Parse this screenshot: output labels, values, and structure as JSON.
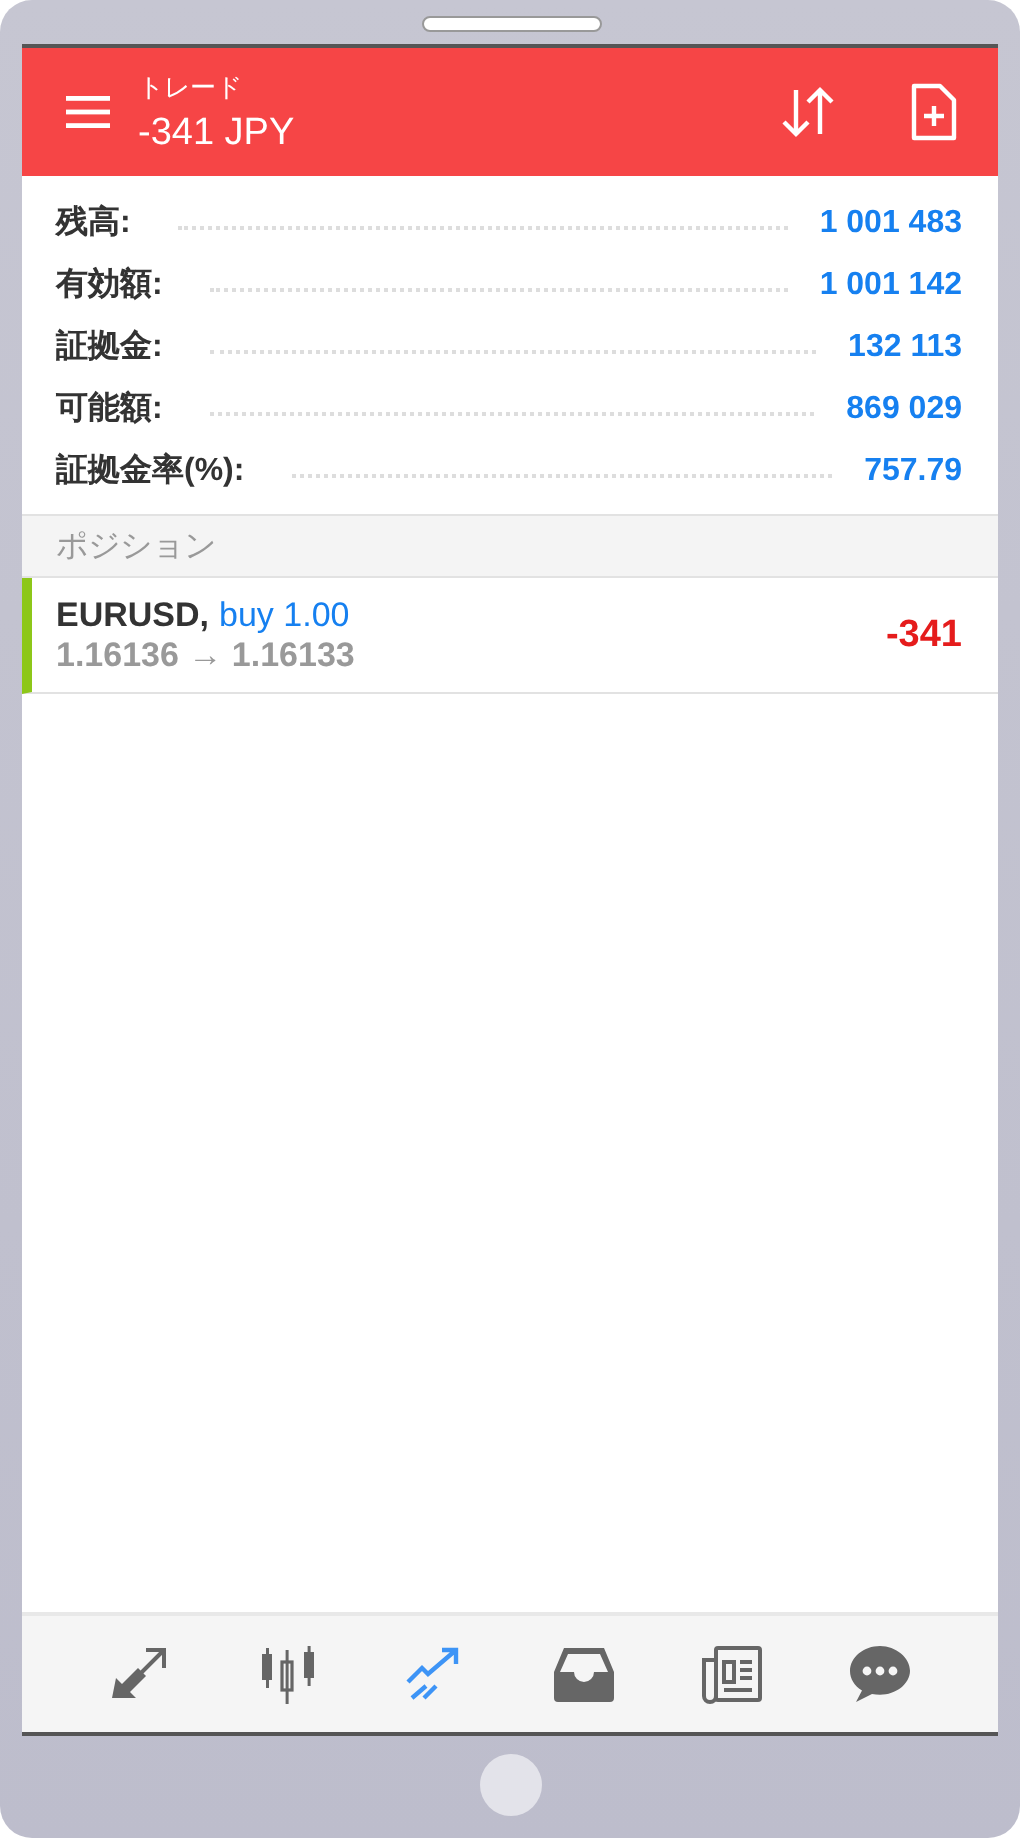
{
  "header": {
    "subtitle": "トレード",
    "title": "-341 JPY"
  },
  "summary": [
    {
      "label": "残高:",
      "value": "1 001 483"
    },
    {
      "label": "有効額:",
      "value": "1 001 142"
    },
    {
      "label": "証拠金:",
      "value": "132 113"
    },
    {
      "label": "可能額:",
      "value": "869 029"
    },
    {
      "label": "証拠金率(%):",
      "value": "757.79"
    }
  ],
  "section": "ポジション",
  "positions": [
    {
      "symbol": "EURUSD,",
      "order": "buy 1.00",
      "prices": "1.16136 → 1.16133",
      "profit": "-341"
    }
  ],
  "nav": [
    {
      "kind": "trade",
      "selected": false
    },
    {
      "kind": "quotes",
      "selected": false
    },
    {
      "kind": "chart",
      "selected": true
    },
    {
      "kind": "inbox",
      "selected": false
    },
    {
      "kind": "news",
      "selected": false
    },
    {
      "kind": "chat",
      "selected": false
    }
  ]
}
